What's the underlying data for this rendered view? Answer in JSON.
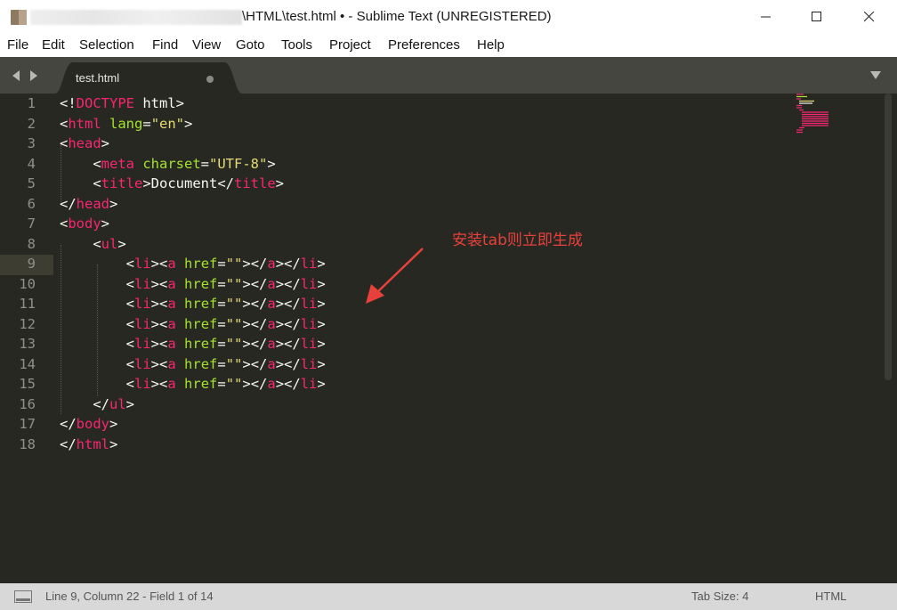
{
  "window": {
    "title": "\\HTML\\test.html • - Sublime Text (UNREGISTERED)"
  },
  "menu": [
    "File",
    "Edit",
    "Selection",
    "Find",
    "View",
    "Goto",
    "Tools",
    "Project",
    "Preferences",
    "Help"
  ],
  "tab": {
    "label": "test.html"
  },
  "editor": {
    "line_numbers": [
      "1",
      "2",
      "3",
      "4",
      "5",
      "6",
      "7",
      "8",
      "9",
      "10",
      "11",
      "12",
      "13",
      "14",
      "15",
      "16",
      "17",
      "18"
    ],
    "current_line": 9,
    "lines": [
      [
        [
          "p",
          "<!"
        ],
        [
          "t",
          "DOCTYPE"
        ],
        [
          "p",
          " html>"
        ]
      ],
      [
        [
          "p",
          "<"
        ],
        [
          "t",
          "html"
        ],
        [
          "p",
          " "
        ],
        [
          "a",
          "lang"
        ],
        [
          "p",
          "="
        ],
        [
          "s",
          "\"en\""
        ],
        [
          "p",
          ">"
        ]
      ],
      [
        [
          "p",
          "<"
        ],
        [
          "t",
          "head"
        ],
        [
          "p",
          ">"
        ]
      ],
      [
        [
          "p",
          "    <"
        ],
        [
          "t",
          "meta"
        ],
        [
          "p",
          " "
        ],
        [
          "a",
          "charset"
        ],
        [
          "p",
          "="
        ],
        [
          "s",
          "\"UTF-8\""
        ],
        [
          "p",
          ">"
        ]
      ],
      [
        [
          "p",
          "    <"
        ],
        [
          "t",
          "title"
        ],
        [
          "p",
          ">Document</"
        ],
        [
          "t",
          "title"
        ],
        [
          "p",
          ">"
        ]
      ],
      [
        [
          "p",
          "</"
        ],
        [
          "t",
          "head"
        ],
        [
          "p",
          ">"
        ]
      ],
      [
        [
          "p",
          "<"
        ],
        [
          "t",
          "body"
        ],
        [
          "p",
          ">"
        ]
      ],
      [
        [
          "p",
          "    <"
        ],
        [
          "t",
          "ul"
        ],
        [
          "p",
          ">"
        ]
      ],
      [
        [
          "p",
          "        <"
        ],
        [
          "t",
          "li"
        ],
        [
          "p",
          "><"
        ],
        [
          "t",
          "a"
        ],
        [
          "p",
          " "
        ],
        [
          "a",
          "href"
        ],
        [
          "p",
          "="
        ],
        [
          "s",
          "\"\""
        ],
        [
          "p",
          "></"
        ],
        [
          "t",
          "a"
        ],
        [
          "p",
          "></"
        ],
        [
          "t",
          "li"
        ],
        [
          "p",
          ">"
        ]
      ],
      [
        [
          "p",
          "        <"
        ],
        [
          "t",
          "li"
        ],
        [
          "p",
          "><"
        ],
        [
          "t",
          "a"
        ],
        [
          "p",
          " "
        ],
        [
          "a",
          "href"
        ],
        [
          "p",
          "="
        ],
        [
          "s",
          "\"\""
        ],
        [
          "p",
          "></"
        ],
        [
          "t",
          "a"
        ],
        [
          "p",
          "></"
        ],
        [
          "t",
          "li"
        ],
        [
          "p",
          ">"
        ]
      ],
      [
        [
          "p",
          "        <"
        ],
        [
          "t",
          "li"
        ],
        [
          "p",
          "><"
        ],
        [
          "t",
          "a"
        ],
        [
          "p",
          " "
        ],
        [
          "a",
          "href"
        ],
        [
          "p",
          "="
        ],
        [
          "s",
          "\"\""
        ],
        [
          "p",
          "></"
        ],
        [
          "t",
          "a"
        ],
        [
          "p",
          "></"
        ],
        [
          "t",
          "li"
        ],
        [
          "p",
          ">"
        ]
      ],
      [
        [
          "p",
          "        <"
        ],
        [
          "t",
          "li"
        ],
        [
          "p",
          "><"
        ],
        [
          "t",
          "a"
        ],
        [
          "p",
          " "
        ],
        [
          "a",
          "href"
        ],
        [
          "p",
          "="
        ],
        [
          "s",
          "\"\""
        ],
        [
          "p",
          "></"
        ],
        [
          "t",
          "a"
        ],
        [
          "p",
          "></"
        ],
        [
          "t",
          "li"
        ],
        [
          "p",
          ">"
        ]
      ],
      [
        [
          "p",
          "        <"
        ],
        [
          "t",
          "li"
        ],
        [
          "p",
          "><"
        ],
        [
          "t",
          "a"
        ],
        [
          "p",
          " "
        ],
        [
          "a",
          "href"
        ],
        [
          "p",
          "="
        ],
        [
          "s",
          "\"\""
        ],
        [
          "p",
          "></"
        ],
        [
          "t",
          "a"
        ],
        [
          "p",
          "></"
        ],
        [
          "t",
          "li"
        ],
        [
          "p",
          ">"
        ]
      ],
      [
        [
          "p",
          "        <"
        ],
        [
          "t",
          "li"
        ],
        [
          "p",
          "><"
        ],
        [
          "t",
          "a"
        ],
        [
          "p",
          " "
        ],
        [
          "a",
          "href"
        ],
        [
          "p",
          "="
        ],
        [
          "s",
          "\"\""
        ],
        [
          "p",
          "></"
        ],
        [
          "t",
          "a"
        ],
        [
          "p",
          "></"
        ],
        [
          "t",
          "li"
        ],
        [
          "p",
          ">"
        ]
      ],
      [
        [
          "p",
          "        <"
        ],
        [
          "t",
          "li"
        ],
        [
          "p",
          "><"
        ],
        [
          "t",
          "a"
        ],
        [
          "p",
          " "
        ],
        [
          "a",
          "href"
        ],
        [
          "p",
          "="
        ],
        [
          "s",
          "\"\""
        ],
        [
          "p",
          "></"
        ],
        [
          "t",
          "a"
        ],
        [
          "p",
          "></"
        ],
        [
          "t",
          "li"
        ],
        [
          "p",
          ">"
        ]
      ],
      [
        [
          "p",
          "    </"
        ],
        [
          "t",
          "ul"
        ],
        [
          "p",
          ">"
        ]
      ],
      [
        [
          "p",
          "</"
        ],
        [
          "t",
          "body"
        ],
        [
          "p",
          ">"
        ]
      ],
      [
        [
          "p",
          "</"
        ],
        [
          "t",
          "html"
        ],
        [
          "p",
          ">"
        ]
      ]
    ]
  },
  "annotation": {
    "text": "安装tab则立即生成",
    "color": "#e8413b"
  },
  "status": {
    "position": "Line 9, Column 22 - Field 1 of 14",
    "tab_size": "Tab Size: 4",
    "syntax": "HTML"
  },
  "colors": {
    "tag": "#f92672",
    "attribute": "#a6e22e",
    "string": "#e6db74",
    "text": "#f8f8f2",
    "background": "#272822"
  },
  "icons": [
    "app-icon",
    "minimize-icon",
    "maximize-icon",
    "close-icon",
    "tab-left-arrow-icon",
    "tab-right-arrow-icon",
    "dirty-dot-icon",
    "tab-dropdown-icon",
    "panel-toggle-icon"
  ]
}
